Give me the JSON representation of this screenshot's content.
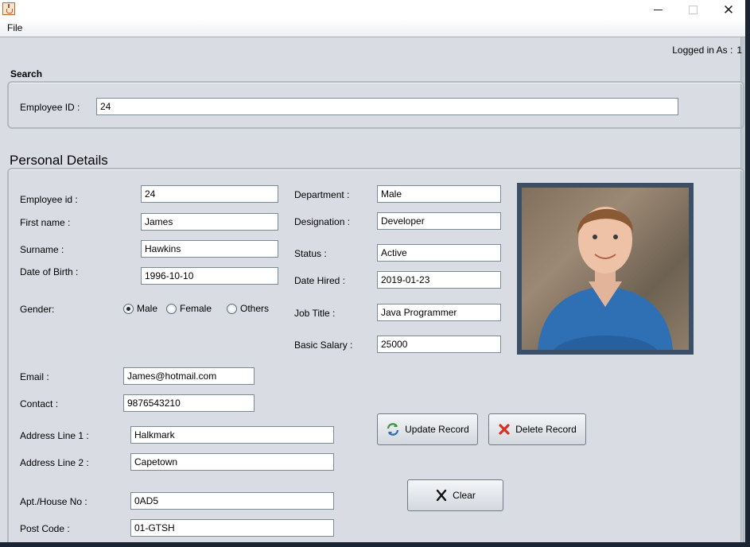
{
  "window": {
    "title": "",
    "controls": {
      "minimize": "minimize-icon",
      "maximize": "maximize-icon",
      "close": "close-icon"
    }
  },
  "menu": {
    "file": "File"
  },
  "session": {
    "label": "Logged in As :",
    "value": "1"
  },
  "search": {
    "title": "Search",
    "employee_id_label": "Employee ID :",
    "employee_id_value": "24"
  },
  "personal": {
    "title": "Personal Details",
    "employee_id_label": "Employee id :",
    "employee_id_value": "24",
    "first_name_label": "First name :",
    "first_name_value": "James",
    "surname_label": "Surname :",
    "surname_value": "Hawkins",
    "dob_label": "Date of Birth :",
    "dob_value": "1996-10-10",
    "gender_label": "Gender:",
    "gender_options": [
      "Male",
      "Female",
      "Others"
    ],
    "gender_selected": "Male",
    "department_label": "Department :",
    "department_value": "Male",
    "designation_label": "Designation :",
    "designation_value": "Developer",
    "status_label": "Status :",
    "status_value": "Active",
    "date_hired_label": "Date Hired :",
    "date_hired_value": "2019-01-23",
    "job_title_label": "Job Title :",
    "job_title_value": "Java Programmer",
    "salary_label": "Basic Salary :",
    "salary_value": "25000",
    "email_label": "Email :",
    "email_value": "James@hotmail.com",
    "contact_label": "Contact :",
    "contact_value": "9876543210",
    "address1_label": "Address Line 1 :",
    "address1_value": "Halkmark",
    "address2_label": "Address Line 2 :",
    "address2_value": "Capetown",
    "apt_label": "Apt./House No :",
    "apt_value": "0AD5",
    "postcode_label": "Post Code :",
    "postcode_value": "01-GTSH"
  },
  "buttons": {
    "update": "Update Record",
    "delete": "Delete Record",
    "clear": "Clear"
  },
  "colors": {
    "window_bg": "#d9dce2",
    "photo_frame": "#3b4f66",
    "sweater": "#2f6fb3",
    "delete_icon": "#d93025",
    "update_icon": "#3c9a3c"
  }
}
